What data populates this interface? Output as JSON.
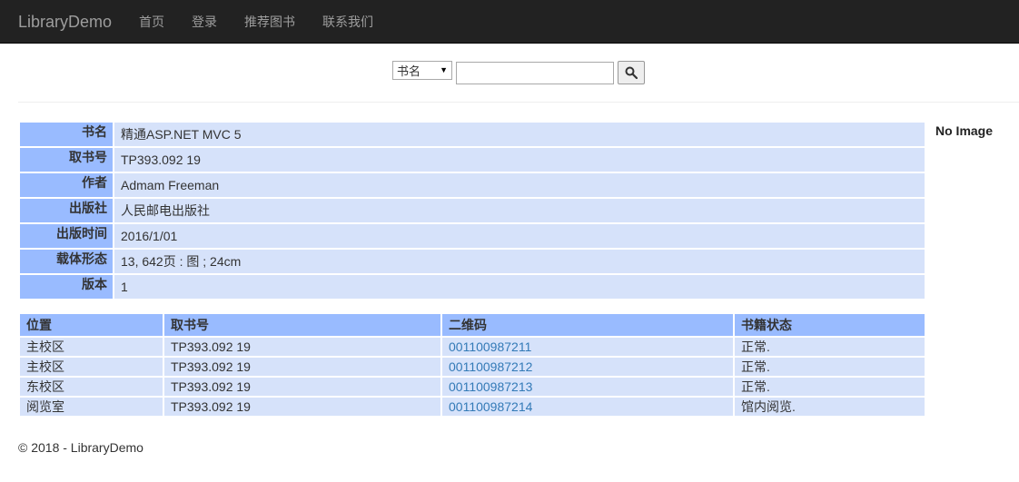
{
  "nav": {
    "brand": "LibraryDemo",
    "links": [
      "首页",
      "登录",
      "推荐图书",
      "联系我们"
    ]
  },
  "search": {
    "field_selected": "书名",
    "input_value": "",
    "button_icon": "search-icon"
  },
  "book": {
    "rows": [
      {
        "label": "书名",
        "value": "精通ASP.NET MVC 5"
      },
      {
        "label": "取书号",
        "value": "TP393.092 19"
      },
      {
        "label": "作者",
        "value": "Admam Freeman"
      },
      {
        "label": "出版社",
        "value": "人民邮电出版社"
      },
      {
        "label": "出版时间",
        "value": "2016/1/01"
      },
      {
        "label": "载体形态",
        "value": "13, 642页 : 图 ; 24cm"
      },
      {
        "label": "版本",
        "value": "1"
      }
    ],
    "image_placeholder": "No Image"
  },
  "copies": {
    "headers": [
      "位置",
      "取书号",
      "二维码",
      "书籍状态"
    ],
    "rows": [
      {
        "location": "主校区",
        "call_no": "TP393.092 19",
        "barcode": "001100987211",
        "status": "正常."
      },
      {
        "location": "主校区",
        "call_no": "TP393.092 19",
        "barcode": "001100987212",
        "status": "正常."
      },
      {
        "location": "东校区",
        "call_no": "TP393.092 19",
        "barcode": "001100987213",
        "status": "正常."
      },
      {
        "location": "阅览室",
        "call_no": "TP393.092 19",
        "barcode": "001100987214",
        "status": "馆内阅览."
      }
    ]
  },
  "footer": {
    "text": "© 2018 - LibraryDemo"
  },
  "colors": {
    "navbar": "#222222",
    "label_bg": "#99bbff",
    "value_bg": "#d6e2fa",
    "link": "#337ab7"
  }
}
